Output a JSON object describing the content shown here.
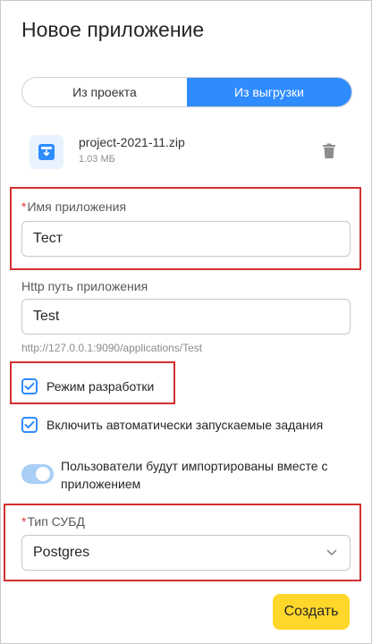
{
  "dialog": {
    "title": "Новое приложение"
  },
  "source_tabs": [
    {
      "label": "Из проекта",
      "active": false
    },
    {
      "label": "Из выгрузки",
      "active": true
    }
  ],
  "file": {
    "name": "project-2021-11.zip",
    "size": "1.03 МБ",
    "icon": "archive-download-icon"
  },
  "app_name": {
    "required_mark": "*",
    "label": "Имя приложения",
    "value": "Тест"
  },
  "http_path": {
    "label": "Http путь приложения",
    "value": "Test",
    "hint": "http://127.0.0.1:9090/applications/Test"
  },
  "options": {
    "dev_mode": {
      "label": "Режим разработки",
      "checked": true
    },
    "auto_jobs": {
      "label": "Включить автоматически запускаемые задания",
      "checked": true
    },
    "import_users": {
      "label": "Пользователи будут импортированы вместе с приложением",
      "on": true
    }
  },
  "db_type": {
    "required_mark": "*",
    "label": "Тип СУБД",
    "value": "Postgres"
  },
  "actions": {
    "create": "Создать"
  },
  "colors": {
    "accent": "#2f8cff",
    "primary_button": "#ffd72a",
    "required": "#e53935",
    "highlight": "#d32f2f"
  }
}
